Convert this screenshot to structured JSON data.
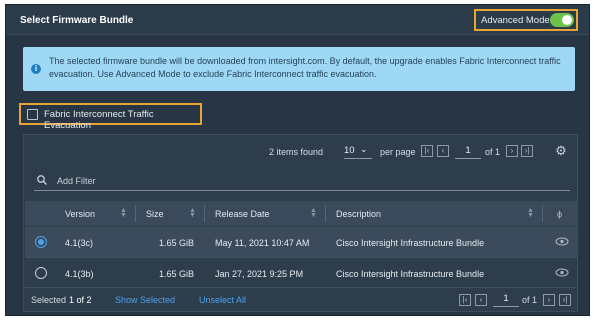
{
  "header": {
    "title": "Select Firmware Bundle",
    "advanced_mode_label": "Advanced Mode",
    "advanced_mode_on": true
  },
  "info": {
    "message": "The selected firmware bundle will be downloaded from intersight.com. By default, the upgrade enables Fabric Interconnect traffic evacuation. Use Advanced Mode to exclude Fabric Interconnect traffic evacuation."
  },
  "options": {
    "fi_traffic_label": "Fabric Interconnect Traffic Evacuation",
    "fi_traffic_checked": false
  },
  "toolbar": {
    "items_found": "2 items found",
    "per_page_value": "10",
    "per_page_label": "per page",
    "page_value": "1",
    "page_of": "of 1"
  },
  "filter": {
    "placeholder": "Add Filter"
  },
  "table": {
    "columns": [
      "Version",
      "Size",
      "Release Date",
      "Description"
    ],
    "rows": [
      {
        "version": "4.1(3c)",
        "size": "1.65 GiB",
        "release_date": "May 11, 2021 10:47 AM",
        "description": "Cisco Intersight Infrastructure Bundle",
        "selected": true
      },
      {
        "version": "4.1(3b)",
        "size": "1.65 GiB",
        "release_date": "Jan 27, 2021 9:25 PM",
        "description": "Cisco Intersight Infrastructure Bundle",
        "selected": false
      }
    ]
  },
  "footer": {
    "selected_prefix": "Selected",
    "selected_count": "1 of 2",
    "show_selected": "Show Selected",
    "unselect_all": "Unselect All",
    "page_value": "1",
    "page_of": "of 1"
  },
  "colors": {
    "accent": "#4aa3f0",
    "highlight_box": "#e8a236",
    "toggle_on": "#6ec24a",
    "info_bg": "#9fd8f5"
  }
}
